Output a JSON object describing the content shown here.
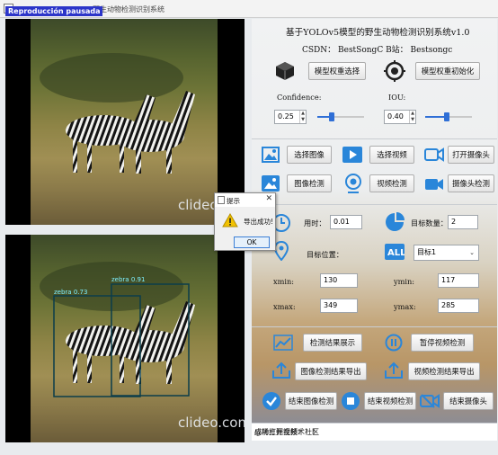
{
  "window": {
    "overlay_badge": "Reproducción pausada",
    "title": "野生动物检测识别系统"
  },
  "video_top": {
    "watermark": "clideo.com"
  },
  "video_bottom": {
    "watermark": "clideo.com",
    "detections": [
      {
        "label": "zebra 0.91"
      },
      {
        "label": "zebra 0.73"
      }
    ]
  },
  "panel": {
    "title": "基于YOLOv5模型的野生动物检测识别系统v1.0",
    "csdn_line": "CSDN： BestSongC   B站： Bestsongc",
    "model_select_button": "模型权重选择",
    "model_init_button": "模型权重初始化",
    "confidence_label": "Confidence:",
    "iou_label": "IOU:",
    "confidence_value": "0.25",
    "iou_value": "0.40",
    "confidence_level": 0.25,
    "iou_level": 0.4,
    "select_image_button": "选择图像",
    "select_video_button": "选择视频",
    "open_camera_button": "打开摄像头",
    "image_detect_button": "图像检测",
    "video_detect_button": "视频检测",
    "camera_detect_button": "摄像头检测",
    "time_label": "用时：",
    "time_value": "0.01",
    "target_count_label": "目标数量：",
    "target_count_value": "2",
    "target_position_label": "目标位置：",
    "target_select_value": "目标1",
    "xmin_label": "xmin:",
    "xmin_value": "130",
    "ymin_label": "ymin:",
    "ymin_value": "117",
    "xmax_label": "xmax:",
    "xmax_value": "349",
    "ymax_label": "ymax:",
    "ymax_value": "285",
    "show_results_button": "检测结果展示",
    "pause_video_button": "暂停视频检测",
    "export_image_button": "图像检测结果导出",
    "export_video_button": "视频检测结果导出",
    "end_image_button": "结束图像检测",
    "end_video_button": "结束视频检测",
    "end_camera_button": "结束摄像头"
  },
  "status": {
    "text": "成功打开视频！！！",
    "site_watermark": "@稀土掘金技术社区"
  },
  "dialog": {
    "title": "提示",
    "message": "导出成功!",
    "ok_button": "OK"
  },
  "colors": {
    "accent": "#2f6fd6",
    "icon_blue": "#2a86d9",
    "badge": "#2c35c9"
  }
}
